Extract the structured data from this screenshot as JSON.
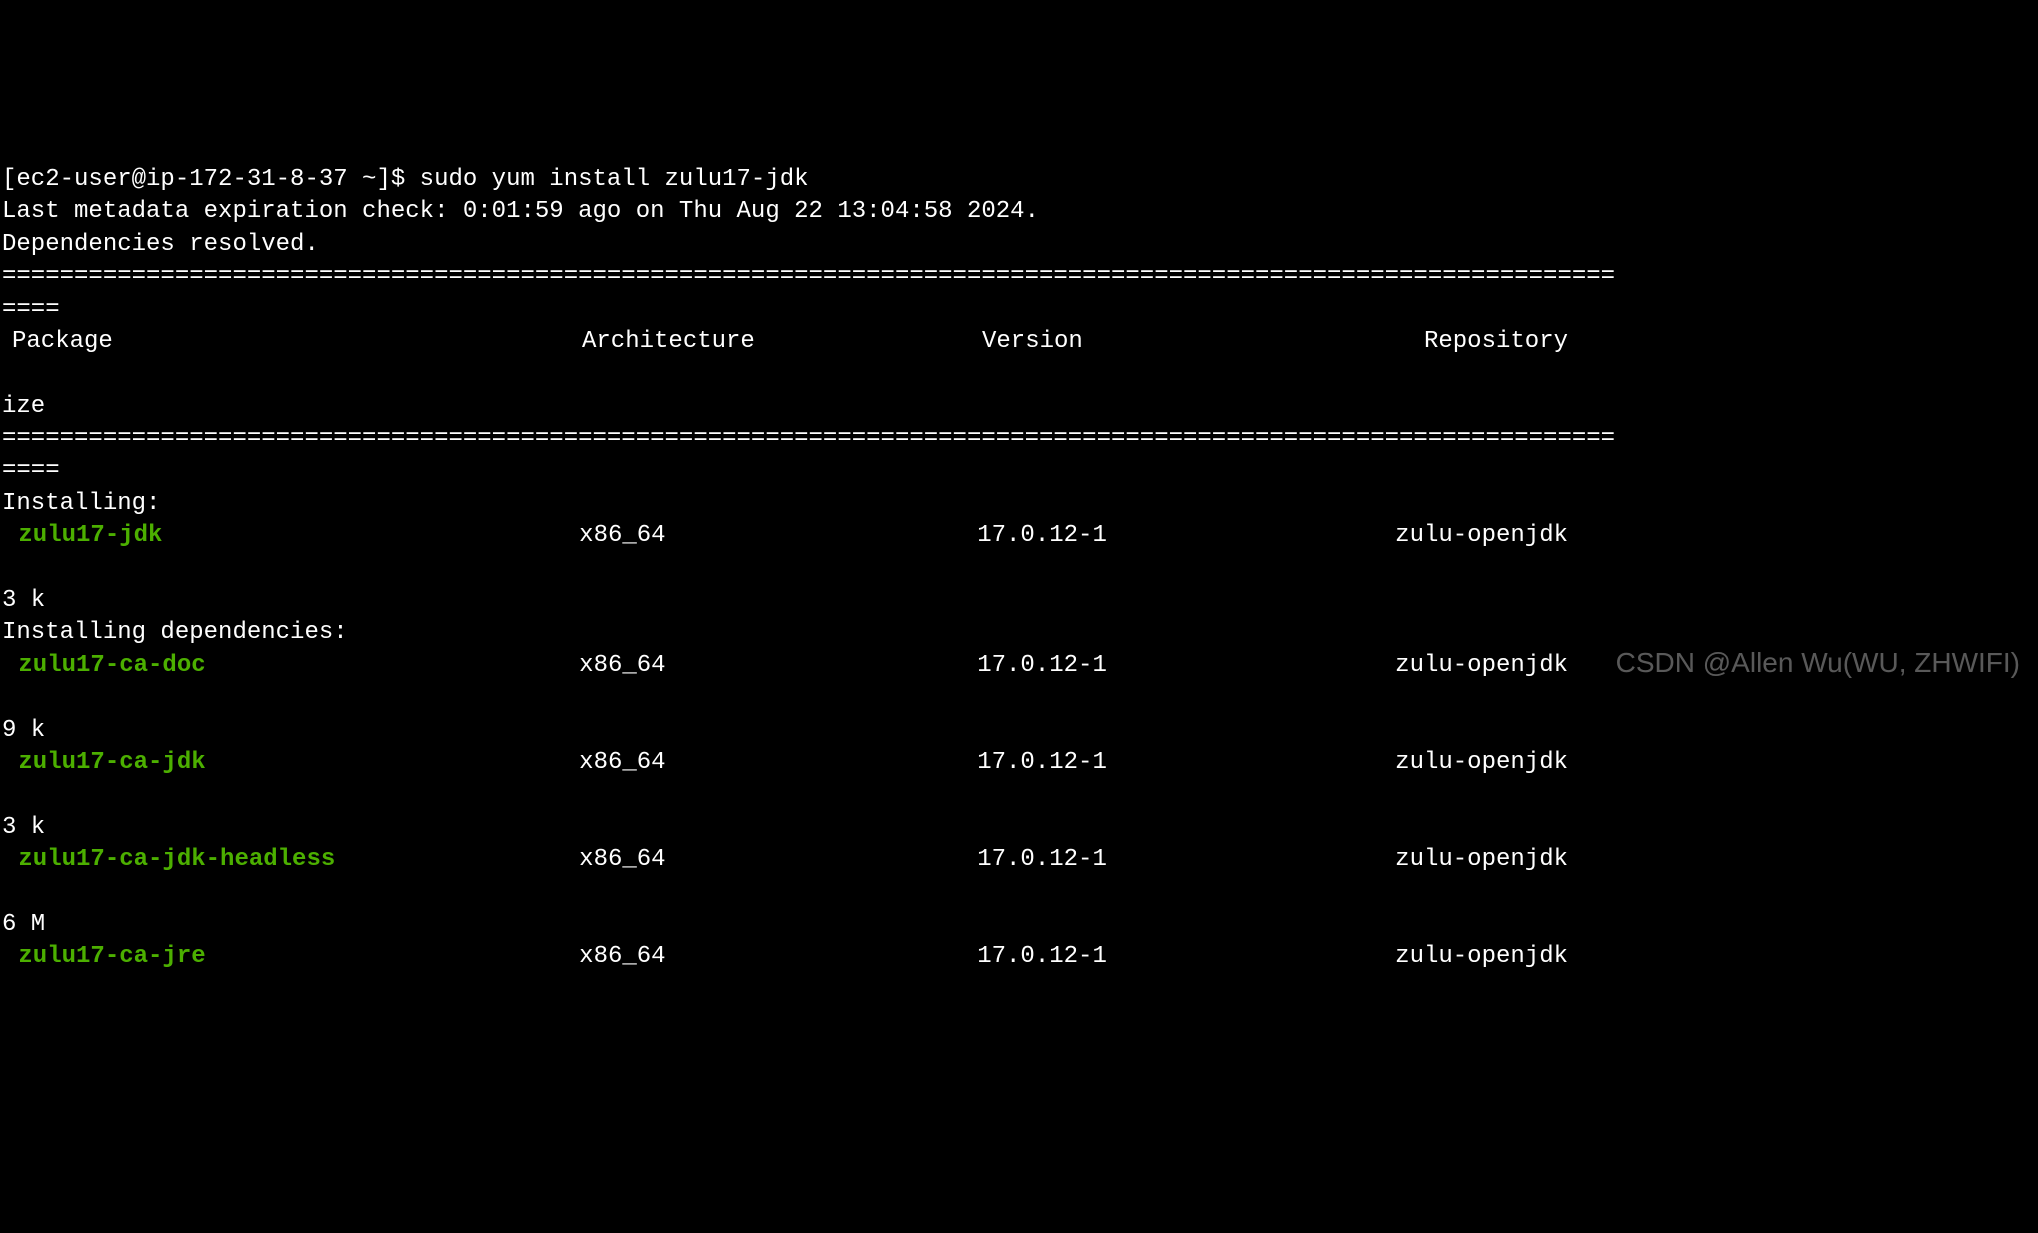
{
  "prompt": {
    "user_host": "[ec2-user@ip-172-31-8-37 ~]$ ",
    "command": "sudo yum install zulu17-jdk"
  },
  "meta_line": "Last metadata expiration check: 0:01:59 ago on Thu Aug 22 13:04:58 2024.",
  "deps_line": "Dependencies resolved.",
  "sep_long": "================================================================================================================",
  "sep_wrap": "====",
  "headers": {
    "package": "Package",
    "arch": "Architecture",
    "version": "Version",
    "repo": "Repository"
  },
  "size_wrap": "ize",
  "sections": {
    "installing": "Installing:",
    "installing_deps": "Installing dependencies:"
  },
  "packages": [
    {
      "name": "zulu17-jdk",
      "arch": "x86_64",
      "version": "17.0.12-1",
      "repo": "zulu-openjdk",
      "size_frag": "3 k"
    },
    {
      "name": "zulu17-ca-doc",
      "arch": "x86_64",
      "version": "17.0.12-1",
      "repo": "zulu-openjdk",
      "size_frag": "9 k"
    },
    {
      "name": "zulu17-ca-jdk",
      "arch": "x86_64",
      "version": "17.0.12-1",
      "repo": "zulu-openjdk",
      "size_frag": "3 k"
    },
    {
      "name": "zulu17-ca-jdk-headless",
      "arch": "x86_64",
      "version": "17.0.12-1",
      "repo": "zulu-openjdk",
      "size_frag": "6 M"
    },
    {
      "name": "zulu17-ca-jre",
      "arch": "x86_64",
      "version": "17.0.12-1",
      "repo": "zulu-openjdk",
      "size_frag": ""
    }
  ],
  "watermark": "CSDN @Allen Wu(WU, ZHWIFI)"
}
